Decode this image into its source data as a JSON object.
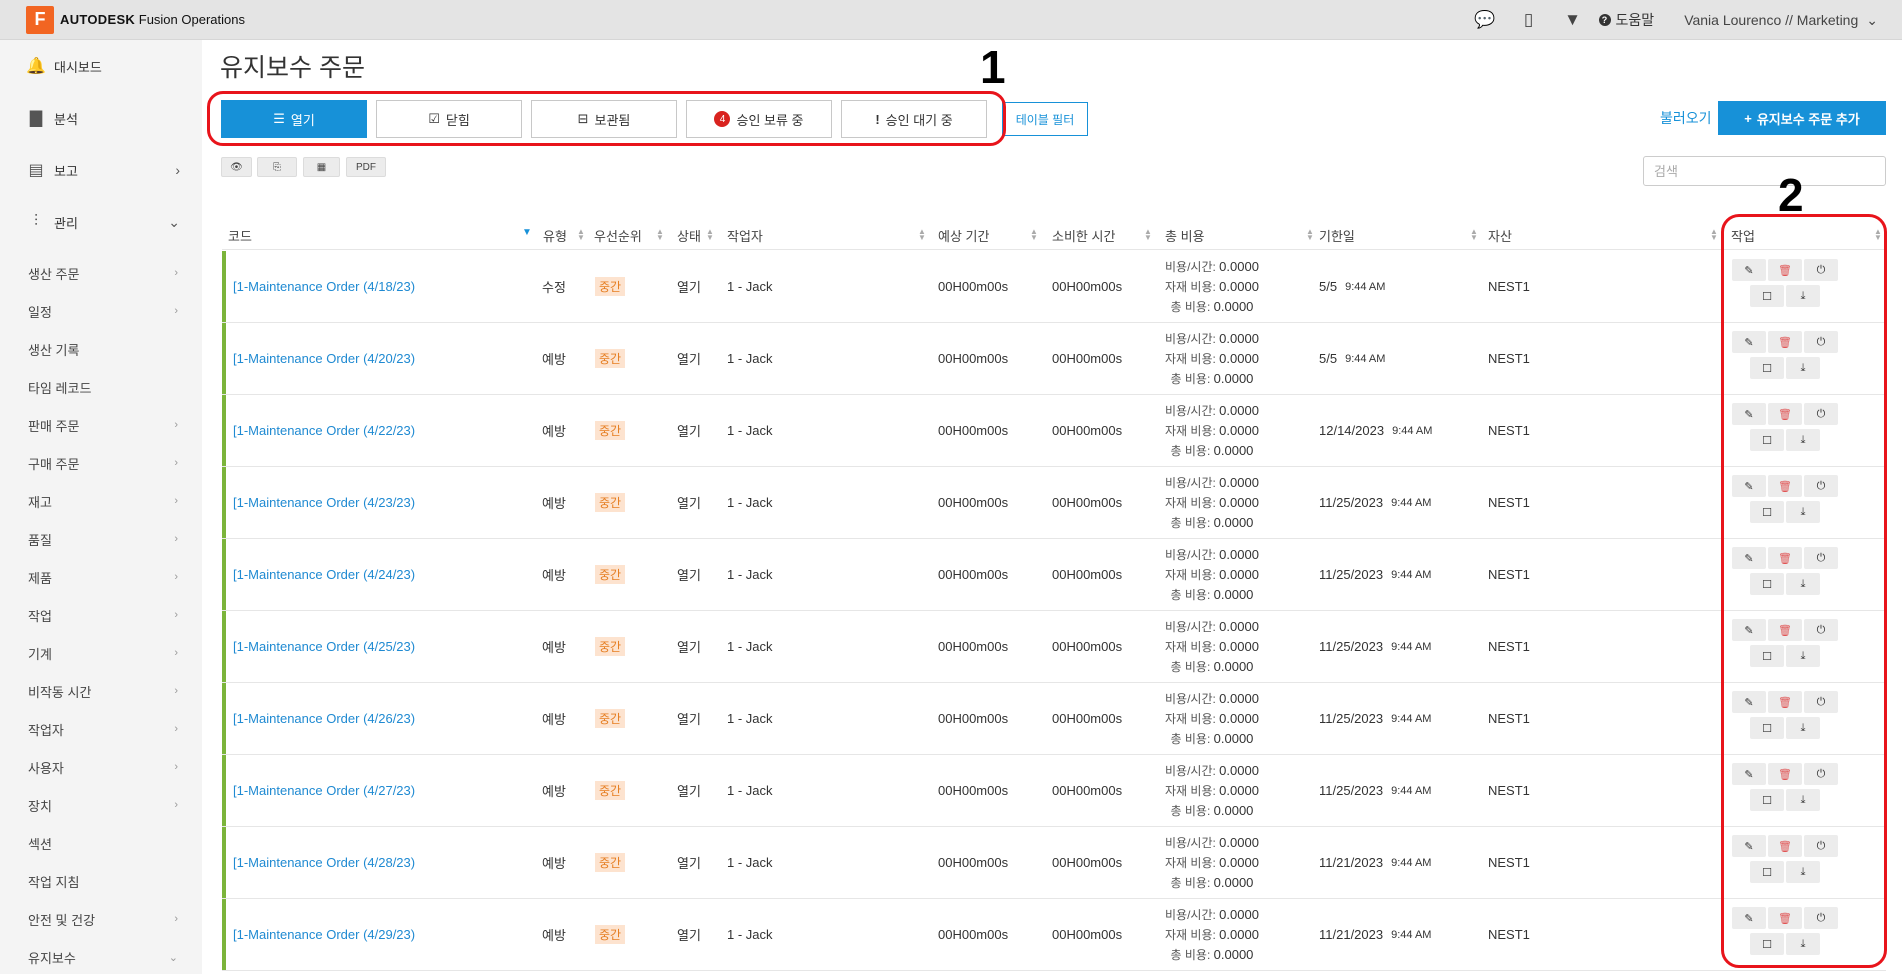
{
  "app": {
    "logo_letter": "F",
    "brand_bold": "AUTODESK",
    "brand_rest": "Fusion Operations"
  },
  "topbar": {
    "help_label": "도움말",
    "user_label": "Vania Lourenco // Marketing"
  },
  "sidebar": {
    "main": [
      {
        "label": "대시보드",
        "icon": "bell-icon"
      },
      {
        "label": "분석",
        "icon": "bar-chart-icon"
      },
      {
        "label": "보고",
        "icon": "report-icon"
      },
      {
        "label": "관리",
        "icon": "sliders-icon"
      }
    ],
    "sub": [
      "생산 주문",
      "일정",
      "생산 기록",
      "타임 레코드",
      "판매 주문",
      "구매 주문",
      "재고",
      "품질",
      "제품",
      "작업",
      "기계",
      "비작동 시간",
      "작업자",
      "사용자",
      "장치",
      "섹션",
      "작업 지침",
      "안전 및 건강",
      "유지보수"
    ]
  },
  "page": {
    "title": "유지보수 주문"
  },
  "tabs": [
    {
      "label": "열기",
      "icon": "list-icon",
      "active": true
    },
    {
      "label": "닫힘",
      "icon": "check-square-icon"
    },
    {
      "label": "보관됨",
      "icon": "archive-icon"
    },
    {
      "label": "승인 보류 중",
      "badge": "4"
    },
    {
      "label": "승인 대기 중",
      "icon": "exclamation-icon"
    }
  ],
  "filter_label": "테이블 필터",
  "load_label": "불러오기",
  "add_label": "유지보수 주문 추가",
  "toolbar": {
    "pdf_label": "PDF"
  },
  "search": {
    "placeholder": "검색"
  },
  "annotations": {
    "one": "1",
    "two": "2"
  },
  "columns": [
    "코드",
    "유형",
    "우선순위",
    "상태",
    "작업자",
    "예상 기간",
    "소비한 시간",
    "총 비용",
    "기한일",
    "자산",
    "작업"
  ],
  "rows": [
    {
      "code": "[1-Maintenance Order (4/18/23)",
      "type": "수정",
      "priority": "중간",
      "status": "열기",
      "operator": "1 - Jack",
      "est": "00H00m00s",
      "spent": "00H00m00s",
      "cost_hour": "0.0000",
      "cost_material": "0.0000",
      "cost_total": "0.0000",
      "due_date": "5/5",
      "due_time": "9:44 AM",
      "asset": "NEST1"
    },
    {
      "code": "[1-Maintenance Order (4/20/23)",
      "type": "예방",
      "priority": "중간",
      "status": "열기",
      "operator": "1 - Jack",
      "est": "00H00m00s",
      "spent": "00H00m00s",
      "cost_hour": "0.0000",
      "cost_material": "0.0000",
      "cost_total": "0.0000",
      "due_date": "5/5",
      "due_time": "9:44 AM",
      "asset": "NEST1"
    },
    {
      "code": "[1-Maintenance Order (4/22/23)",
      "type": "예방",
      "priority": "중간",
      "status": "열기",
      "operator": "1 - Jack",
      "est": "00H00m00s",
      "spent": "00H00m00s",
      "cost_hour": "0.0000",
      "cost_material": "0.0000",
      "cost_total": "0.0000",
      "due_date": "12/14/2023",
      "due_time": "9:44 AM",
      "asset": "NEST1"
    },
    {
      "code": "[1-Maintenance Order (4/23/23)",
      "type": "예방",
      "priority": "중간",
      "status": "열기",
      "operator": "1 - Jack",
      "est": "00H00m00s",
      "spent": "00H00m00s",
      "cost_hour": "0.0000",
      "cost_material": "0.0000",
      "cost_total": "0.0000",
      "due_date": "11/25/2023",
      "due_time": "9:44 AM",
      "asset": "NEST1"
    },
    {
      "code": "[1-Maintenance Order (4/24/23)",
      "type": "예방",
      "priority": "중간",
      "status": "열기",
      "operator": "1 - Jack",
      "est": "00H00m00s",
      "spent": "00H00m00s",
      "cost_hour": "0.0000",
      "cost_material": "0.0000",
      "cost_total": "0.0000",
      "due_date": "11/25/2023",
      "due_time": "9:44 AM",
      "asset": "NEST1"
    },
    {
      "code": "[1-Maintenance Order (4/25/23)",
      "type": "예방",
      "priority": "중간",
      "status": "열기",
      "operator": "1 - Jack",
      "est": "00H00m00s",
      "spent": "00H00m00s",
      "cost_hour": "0.0000",
      "cost_material": "0.0000",
      "cost_total": "0.0000",
      "due_date": "11/25/2023",
      "due_time": "9:44 AM",
      "asset": "NEST1"
    },
    {
      "code": "[1-Maintenance Order (4/26/23)",
      "type": "예방",
      "priority": "중간",
      "status": "열기",
      "operator": "1 - Jack",
      "est": "00H00m00s",
      "spent": "00H00m00s",
      "cost_hour": "0.0000",
      "cost_material": "0.0000",
      "cost_total": "0.0000",
      "due_date": "11/25/2023",
      "due_time": "9:44 AM",
      "asset": "NEST1"
    },
    {
      "code": "[1-Maintenance Order (4/27/23)",
      "type": "예방",
      "priority": "중간",
      "status": "열기",
      "operator": "1 - Jack",
      "est": "00H00m00s",
      "spent": "00H00m00s",
      "cost_hour": "0.0000",
      "cost_material": "0.0000",
      "cost_total": "0.0000",
      "due_date": "11/25/2023",
      "due_time": "9:44 AM",
      "asset": "NEST1"
    },
    {
      "code": "[1-Maintenance Order (4/28/23)",
      "type": "예방",
      "priority": "중간",
      "status": "열기",
      "operator": "1 - Jack",
      "est": "00H00m00s",
      "spent": "00H00m00s",
      "cost_hour": "0.0000",
      "cost_material": "0.0000",
      "cost_total": "0.0000",
      "due_date": "11/21/2023",
      "due_time": "9:44 AM",
      "asset": "NEST1"
    },
    {
      "code": "[1-Maintenance Order (4/29/23)",
      "type": "예방",
      "priority": "중간",
      "status": "열기",
      "operator": "1 - Jack",
      "est": "00H00m00s",
      "spent": "00H00m00s",
      "cost_hour": "0.0000",
      "cost_material": "0.0000",
      "cost_total": "0.0000",
      "due_date": "11/21/2023",
      "due_time": "9:44 AM",
      "asset": "NEST1"
    }
  ],
  "cost_labels": {
    "hour": "비용/시간: ",
    "material": "자재 비용: ",
    "total": "총 비용: "
  },
  "colors": {
    "primary": "#1791d8",
    "highlight": "#e8141b",
    "row_bar": "#7bb43a",
    "priority_bg": "#fde3cf",
    "priority_text": "#e67e22"
  }
}
